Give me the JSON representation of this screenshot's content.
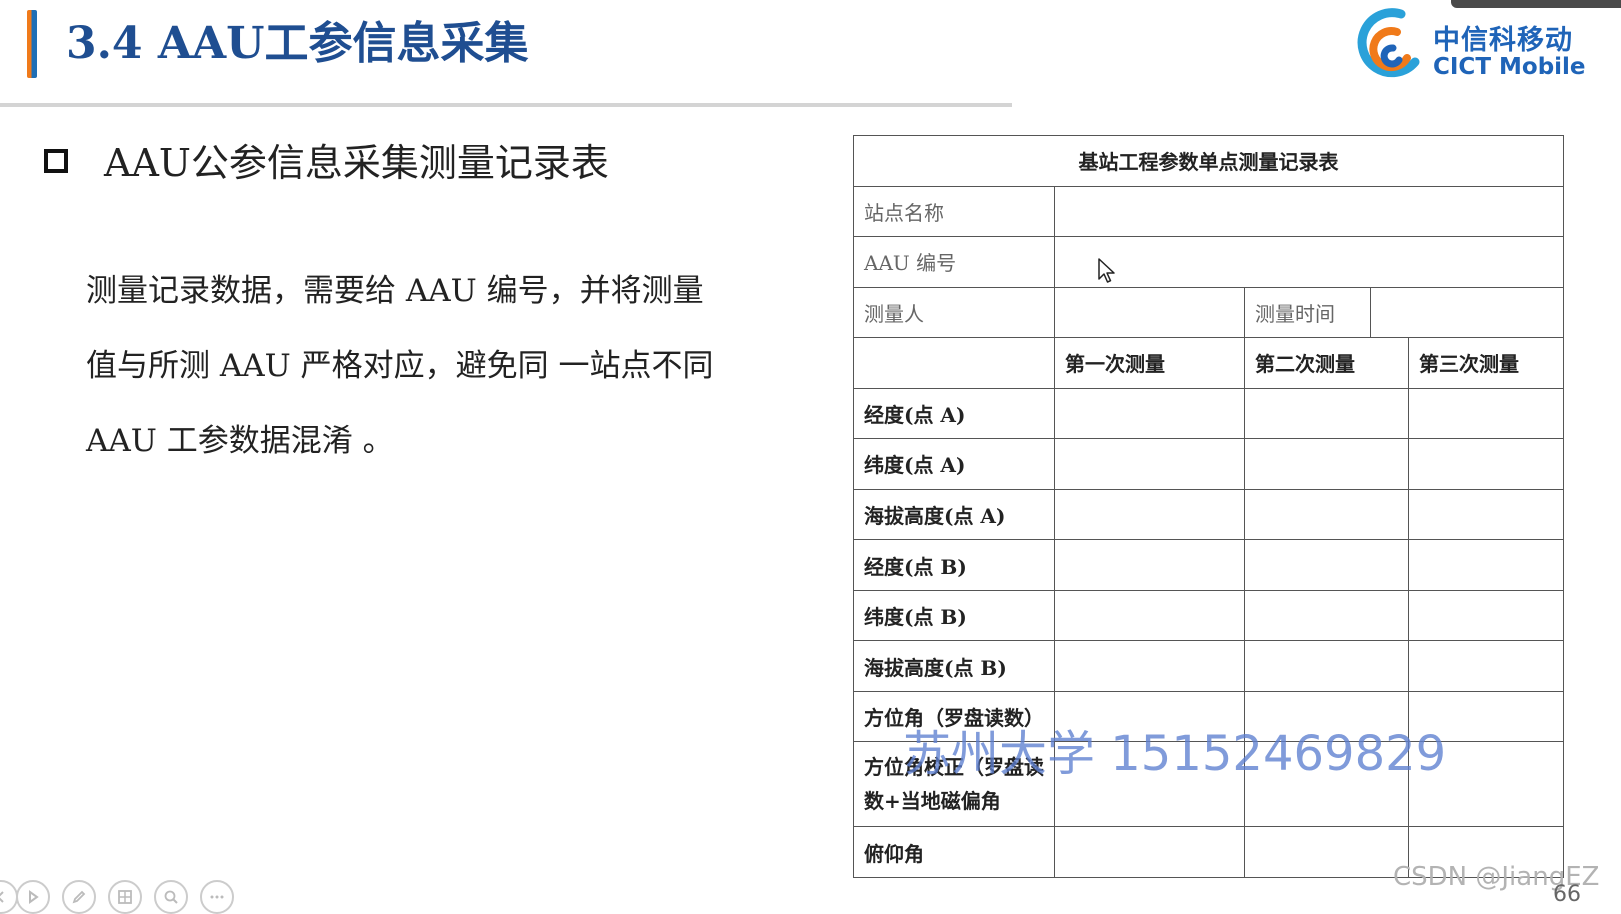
{
  "header": {
    "title": "3.4 AAU工参信息采集",
    "logo_cn": "中信科移动",
    "logo_en": "CICT Mobile"
  },
  "section": {
    "heading": "AAU公参信息采集测量记录表",
    "paragraph_lines": [
      "测量记录数据，需要给 AAU 编号，并将测量",
      "值与所测 AAU 严格对应，避免同 一站点不同",
      "AAU 工参数据混淆 。"
    ]
  },
  "record_table": {
    "title": "基站工程参数单点测量记录表",
    "site_name_label": "站点名称",
    "aau_number_label": "AAU 编号",
    "surveyor_label": "测量人",
    "measure_time_label": "测量时间",
    "column_headers": [
      "第一次测量",
      "第二次测量",
      "第三次测量"
    ],
    "row_labels": [
      "经度(点 A)",
      "纬度(点 A)",
      "海拔高度(点 A)",
      "经度(点 B)",
      "纬度(点 B)",
      "海拔高度(点 B)",
      "方位角（罗盘读数）",
      "方位角校正（罗盘读数+当地磁偏角",
      "俯仰角"
    ]
  },
  "watermark": "苏州大学 15152469829",
  "footer": {
    "csdn_mark": "CSDN @JiangEZ",
    "page_number": "66"
  },
  "colors": {
    "title": "#1f4e91",
    "accent_orange": "#f07a1a",
    "accent_blue": "#1f6fb6",
    "logo_blue": "#1f64b8",
    "watermark": "#5d7fd0"
  },
  "icons": [
    "logo-mark-icon",
    "mouse-cursor-icon",
    "slide-prev-icon",
    "slide-play-icon",
    "pen-icon",
    "slides-grid-icon",
    "zoom-icon",
    "more-icon"
  ]
}
